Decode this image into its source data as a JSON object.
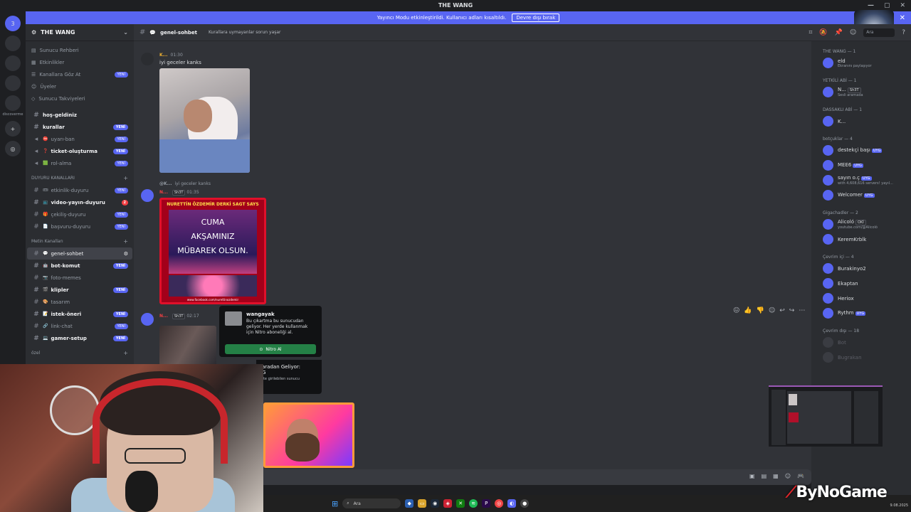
{
  "window": {
    "title": "THE WANG",
    "controls": [
      "—",
      "▢",
      "✕"
    ]
  },
  "notice": {
    "text": "Yayıncı Modu etkinleştirildi. Kullanıcı adları kısaltıldı.",
    "button": "Devre dışı bırak"
  },
  "servers": {
    "dm_badge": "3",
    "label": "discoverme"
  },
  "guild": {
    "name": "THE WANG"
  },
  "nav": [
    {
      "label": "Sunucu Rehberi"
    },
    {
      "label": "Etkinlikler"
    },
    {
      "label": "Kanallara Göz At",
      "badge": "YENİ"
    },
    {
      "label": "Üyeler"
    },
    {
      "label": "Sunucu Takviyeleri"
    }
  ],
  "channels_top": [
    {
      "name": "hoş-geldiniz",
      "bold": true
    },
    {
      "name": "kurallar",
      "bold": true,
      "badge": "YENİ"
    },
    {
      "name": "uyarı-ban",
      "emoji": "⛔",
      "badge": "YENİ"
    },
    {
      "name": "ticket-oluşturma",
      "emoji": "❓",
      "bold": true,
      "badge": "YENİ"
    },
    {
      "name": "rol-alma",
      "emoji": "🟩",
      "badge": "YENİ"
    }
  ],
  "category_duyuru": "DUYURU KANALLARI",
  "channels_duyuru": [
    {
      "name": "etkinlik-duyuru",
      "emoji": "🎟",
      "badge": "YENİ"
    },
    {
      "name": "video-yayın-duyuru",
      "emoji": "📺",
      "bold": true,
      "badge": "2"
    },
    {
      "name": "çekiliş-duyuru",
      "emoji": "🎁",
      "badge": "YENİ"
    },
    {
      "name": "başvuru-duyuru",
      "emoji": "📄",
      "badge": "YENİ"
    }
  ],
  "category_metin": "Metin Kanalları",
  "channels_metin": [
    {
      "name": "genel-sohbet",
      "emoji": "💬",
      "selected": true
    },
    {
      "name": "bot-komut",
      "emoji": "🤖",
      "bold": true,
      "badge": "YENİ"
    },
    {
      "name": "foto-memes",
      "emoji": "📷"
    },
    {
      "name": "klipler",
      "emoji": "🎬",
      "bold": true,
      "badge": "YENİ"
    },
    {
      "name": "tasarım",
      "emoji": "🎨"
    },
    {
      "name": "istek-öneri",
      "emoji": "📝",
      "bold": true,
      "badge": "YENİ"
    },
    {
      "name": "link-chat",
      "emoji": "🔗",
      "badge": "YENİ"
    },
    {
      "name": "gamer-setup",
      "emoji": "💻",
      "bold": true,
      "badge": "YENİ"
    }
  ],
  "category_ozel": "özel",
  "header": {
    "channel": "genel-sohbet",
    "topic": "Kurallara uymayanlar sorun yaşar",
    "search": "Ara"
  },
  "messages": [
    {
      "author": "K...",
      "time": "01:30",
      "text": "iyi geceler kanks"
    },
    {
      "reply": "iyi geceler kanks",
      "reply_author": "@K...",
      "author": "N...",
      "role": "Sh3T",
      "time": "01:35",
      "image_text": [
        "NURETTİN ÖZDEMİR DERKİ SAGT SAYS",
        "CUMA",
        "AKŞAMINIZ",
        "MÜBAREK OLSUN.",
        "www.facebook.com/nurettinozdemir"
      ]
    },
    {
      "author": "N...",
      "role": "Sh3T",
      "time": "02:17"
    }
  ],
  "popup": {
    "title": "wangayak",
    "desc": "Bu çıkartma bu sunucudan geliyor. Her yerde kullanmak için Nitro aboneliği al.",
    "button": "Nitro Al"
  },
  "popup2": {
    "title": "aradan Geliyor:",
    "line": "G",
    "sub": "tte girilebilen sunucu"
  },
  "members": [
    {
      "group": "THE WANG — 1",
      "items": [
        {
          "name": "eld",
          "sub": "Ekranını paylaşıyor"
        }
      ]
    },
    {
      "group": "YETKİLİ ABİ — 1",
      "items": [
        {
          "name": "N...",
          "role": "Sh3T",
          "sub": "Sesli aramada"
        }
      ]
    },
    {
      "group": "DASSAKLI ABİ — 1",
      "items": [
        {
          "name": "K..."
        }
      ]
    },
    {
      "group": "botçuklar — 4",
      "items": [
        {
          "name": "destekçi başı",
          "bot": "UYG"
        },
        {
          "name": "MEE6",
          "bot": "UYG"
        },
        {
          "name": "sayın o.ç",
          "bot": "UYG",
          "sub": "with 4,608,616 servers! yayıl..."
        },
        {
          "name": "Welcomer",
          "bot": "UYG"
        }
      ]
    },
    {
      "group": "Gigachadler — 2",
      "items": [
        {
          "name": "Alicoló",
          "role": "OKİ",
          "sub": "youtube.com/@Alicoló"
        },
        {
          "name": "KeremKrblk"
        }
      ]
    },
    {
      "group": "Çevrim içi — 4",
      "items": [
        {
          "name": "Burakinyo2"
        },
        {
          "name": "Ekaptan"
        },
        {
          "name": "Heriox"
        },
        {
          "name": "Rythm",
          "bot": "UYG"
        }
      ]
    },
    {
      "group": "Çevrim dışı — 18",
      "items": [
        {
          "name": "Bot"
        },
        {
          "name": "Bugrakan"
        }
      ],
      "offline": true
    }
  ],
  "taskbar": {
    "search": "Ara"
  },
  "watermark": {
    "brand": "ByNoGame",
    "date": "9.08.2025"
  },
  "colors": {
    "accent": "#5865f2",
    "nitro": "#248046",
    "brand_red": "#e0262b"
  }
}
